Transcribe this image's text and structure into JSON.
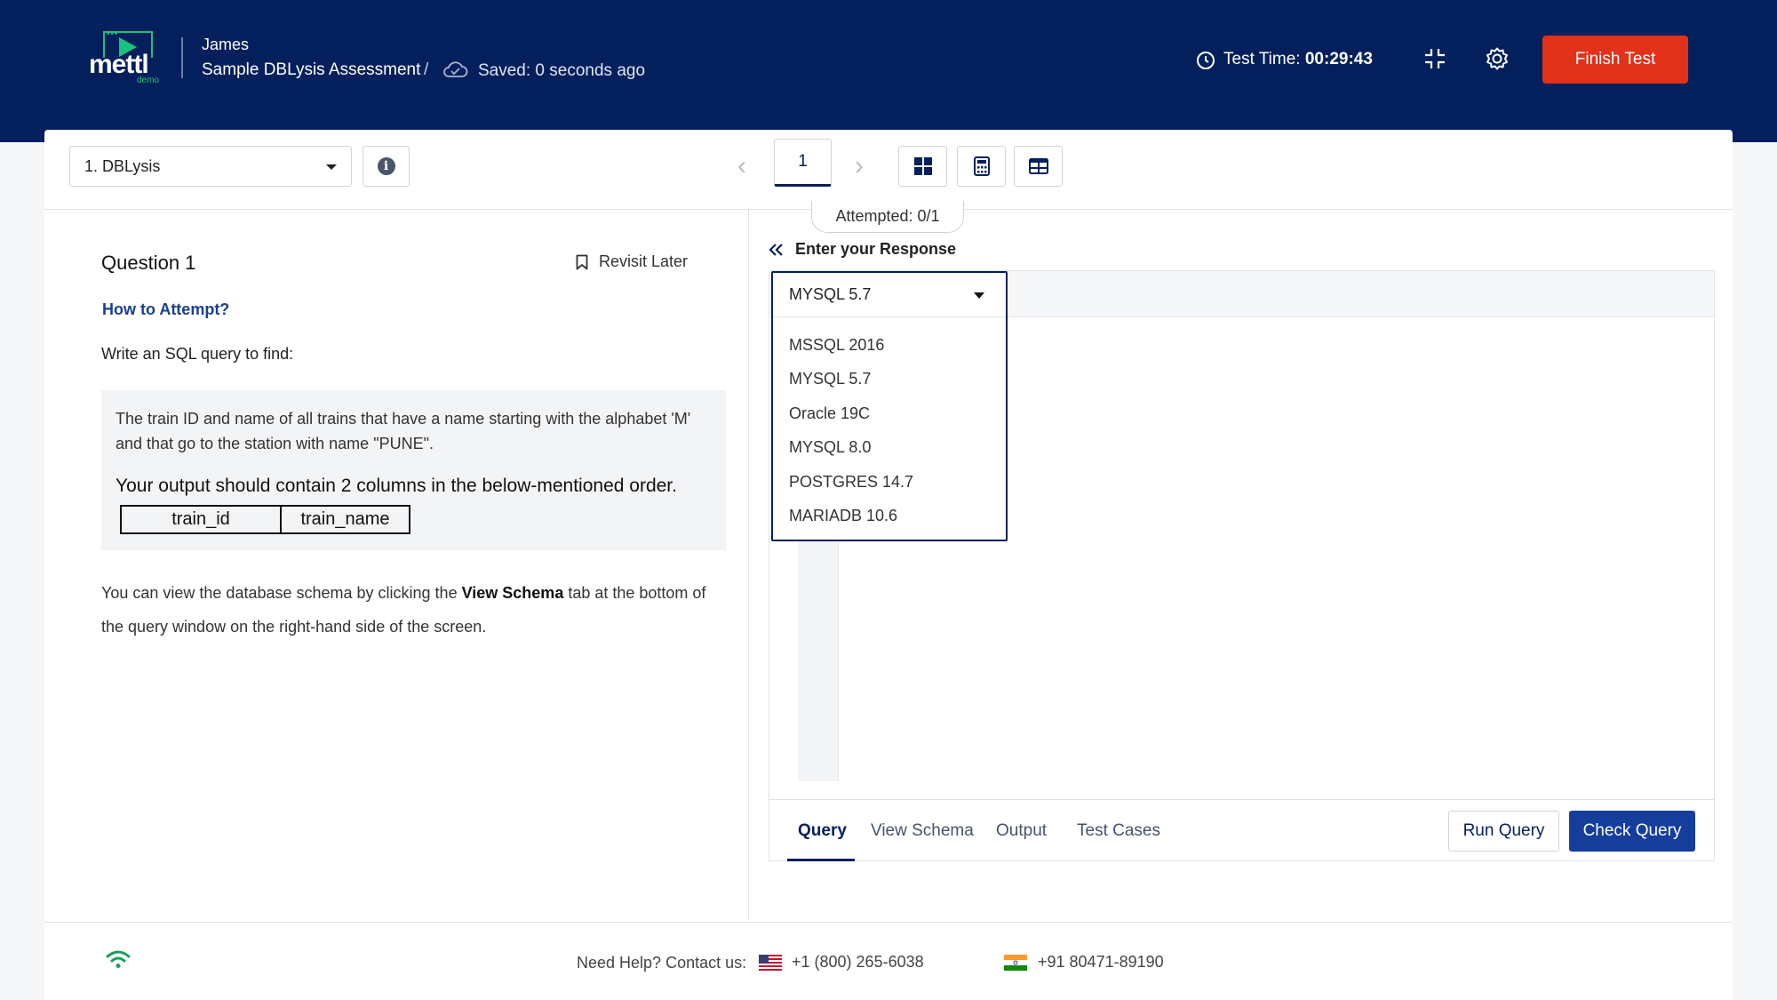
{
  "header": {
    "logo_text": "mettl",
    "logo_sub": "demo",
    "user_name": "James",
    "assessment_name": "Sample DBLysis Assessment",
    "separator": "/",
    "saved_status": "Saved: 0 seconds ago",
    "test_time_label": "Test Time:",
    "test_time_value": "00:29:43",
    "finish_label": "Finish Test",
    "accent_color": "#e2321a",
    "brand_color": "#03205c"
  },
  "toolbar": {
    "section_value": "1. DBLysis",
    "question_number": "1",
    "attempted": "Attempted: 0/1",
    "tools": [
      "grid-icon",
      "calculator-icon",
      "table-icon"
    ]
  },
  "question": {
    "title": "Question 1",
    "revisit_label": "Revisit Later",
    "how_to": "How to Attempt?",
    "intro": "Write an SQL query to find:",
    "description": "The train ID and name of all trains that have a name starting with the alphabet 'M' and that go to the station with name \"PUNE\".",
    "output_note": "Your output should contain 2 columns in the below-mentioned order.",
    "columns": [
      "train_id",
      "train_name"
    ],
    "schema_prefix": "You can view the database schema by clicking the ",
    "schema_link": "View Schema",
    "schema_suffix": " tab at the bottom of the query window on the right-hand side of the screen."
  },
  "response": {
    "heading": "Enter your Response",
    "selected_language": "MYSQL 5.7",
    "languages": [
      "MSSQL 2016",
      "MYSQL 5.7",
      "Oracle 19C",
      "MYSQL 8.0",
      "POSTGRES 14.7",
      "MARIADB 10.6"
    ],
    "tabs": [
      "Query",
      "View Schema",
      "Output",
      "Test Cases"
    ],
    "active_tab": "Query",
    "run_label": "Run Query",
    "check_label": "Check Query"
  },
  "footer": {
    "help_label": "Need Help? Contact us:",
    "phone_us": "+1 (800) 265-6038",
    "phone_in": "+91 80471-89190"
  }
}
